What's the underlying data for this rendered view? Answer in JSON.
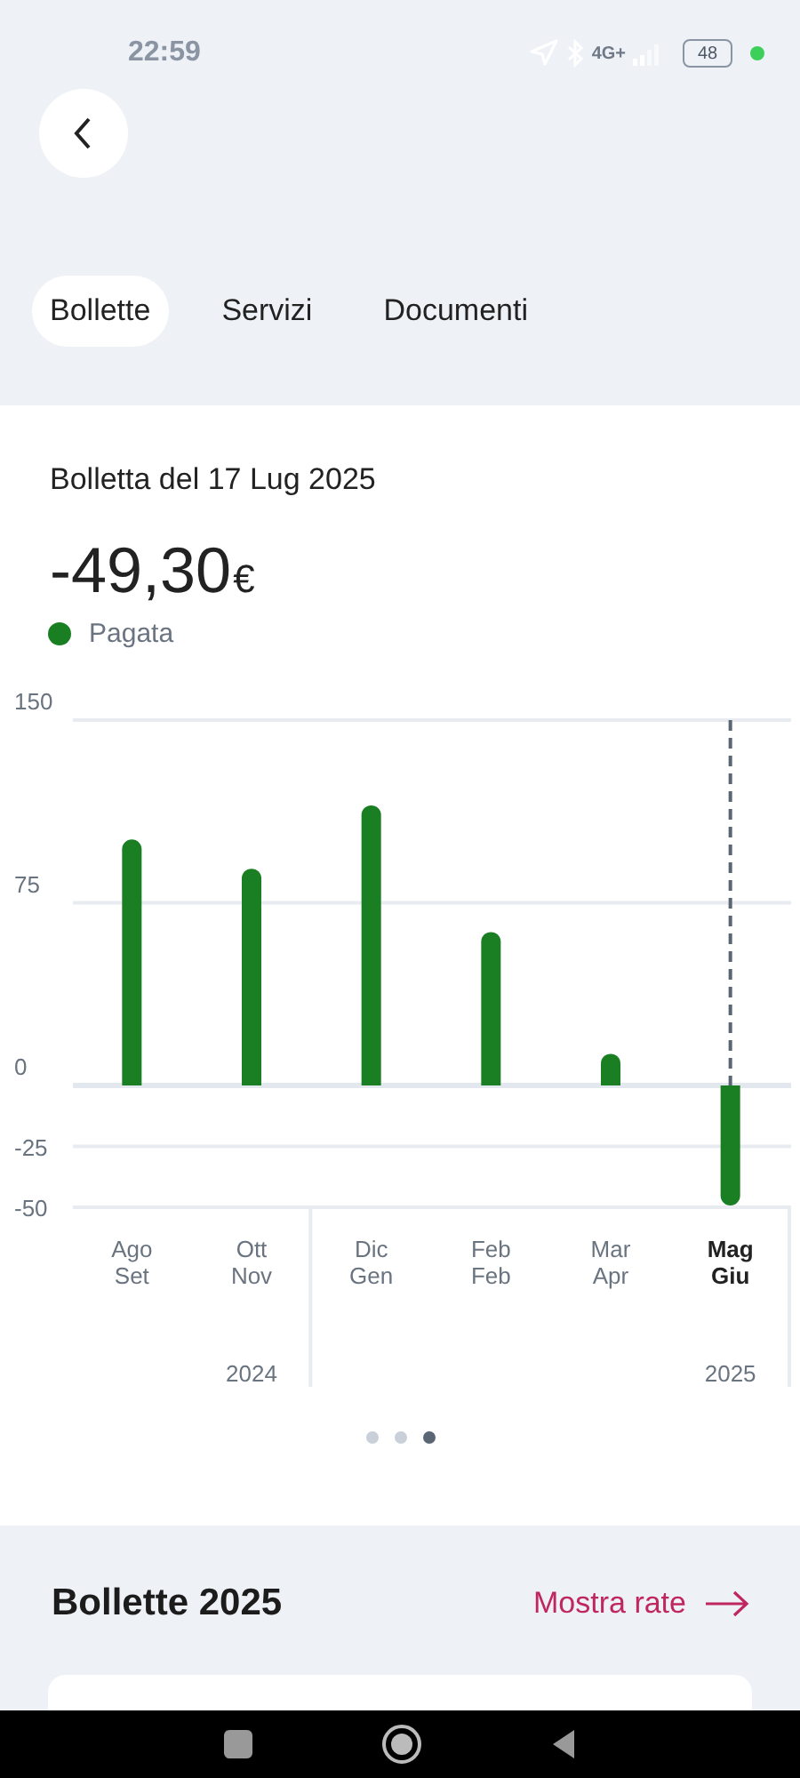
{
  "status_bar": {
    "time": "22:59",
    "network": "4G+",
    "battery": "48"
  },
  "tabs": [
    {
      "label": "Bollette",
      "selected": true
    },
    {
      "label": "Servizi",
      "selected": false
    },
    {
      "label": "Documenti",
      "selected": false
    }
  ],
  "bill": {
    "title": "Bolletta del 17 Lug 2025",
    "amount": "-49,30",
    "currency": "€",
    "status": "Pagata",
    "chart_data": {
      "type": "bar",
      "categories": [
        "Ago\nSet",
        "Ott\nNov",
        "Dic\nGen",
        "Feb\nFeb",
        "Mar\nApr",
        "Mag\nGiu"
      ],
      "series": [
        {
          "color": "#1a7f22",
          "values": [
            101,
            89,
            115,
            63,
            13,
            -49.3
          ]
        }
      ],
      "ylim": [
        -50,
        150
      ],
      "yticks": [
        150,
        75,
        0,
        -25,
        -50
      ]
    },
    "periods": [
      {
        "selected": false
      },
      {
        "selected": false,
        "year": "2024"
      },
      {
        "selected": false
      },
      {
        "selected": false
      },
      {
        "selected": false
      },
      {
        "selected": true,
        "year": "2025"
      }
    ],
    "pager": [
      {
        "selected": false
      },
      {
        "selected": false
      },
      {
        "selected": true
      }
    ]
  },
  "section": {
    "title": "Bollette 2025",
    "link": "Mostra rate"
  }
}
